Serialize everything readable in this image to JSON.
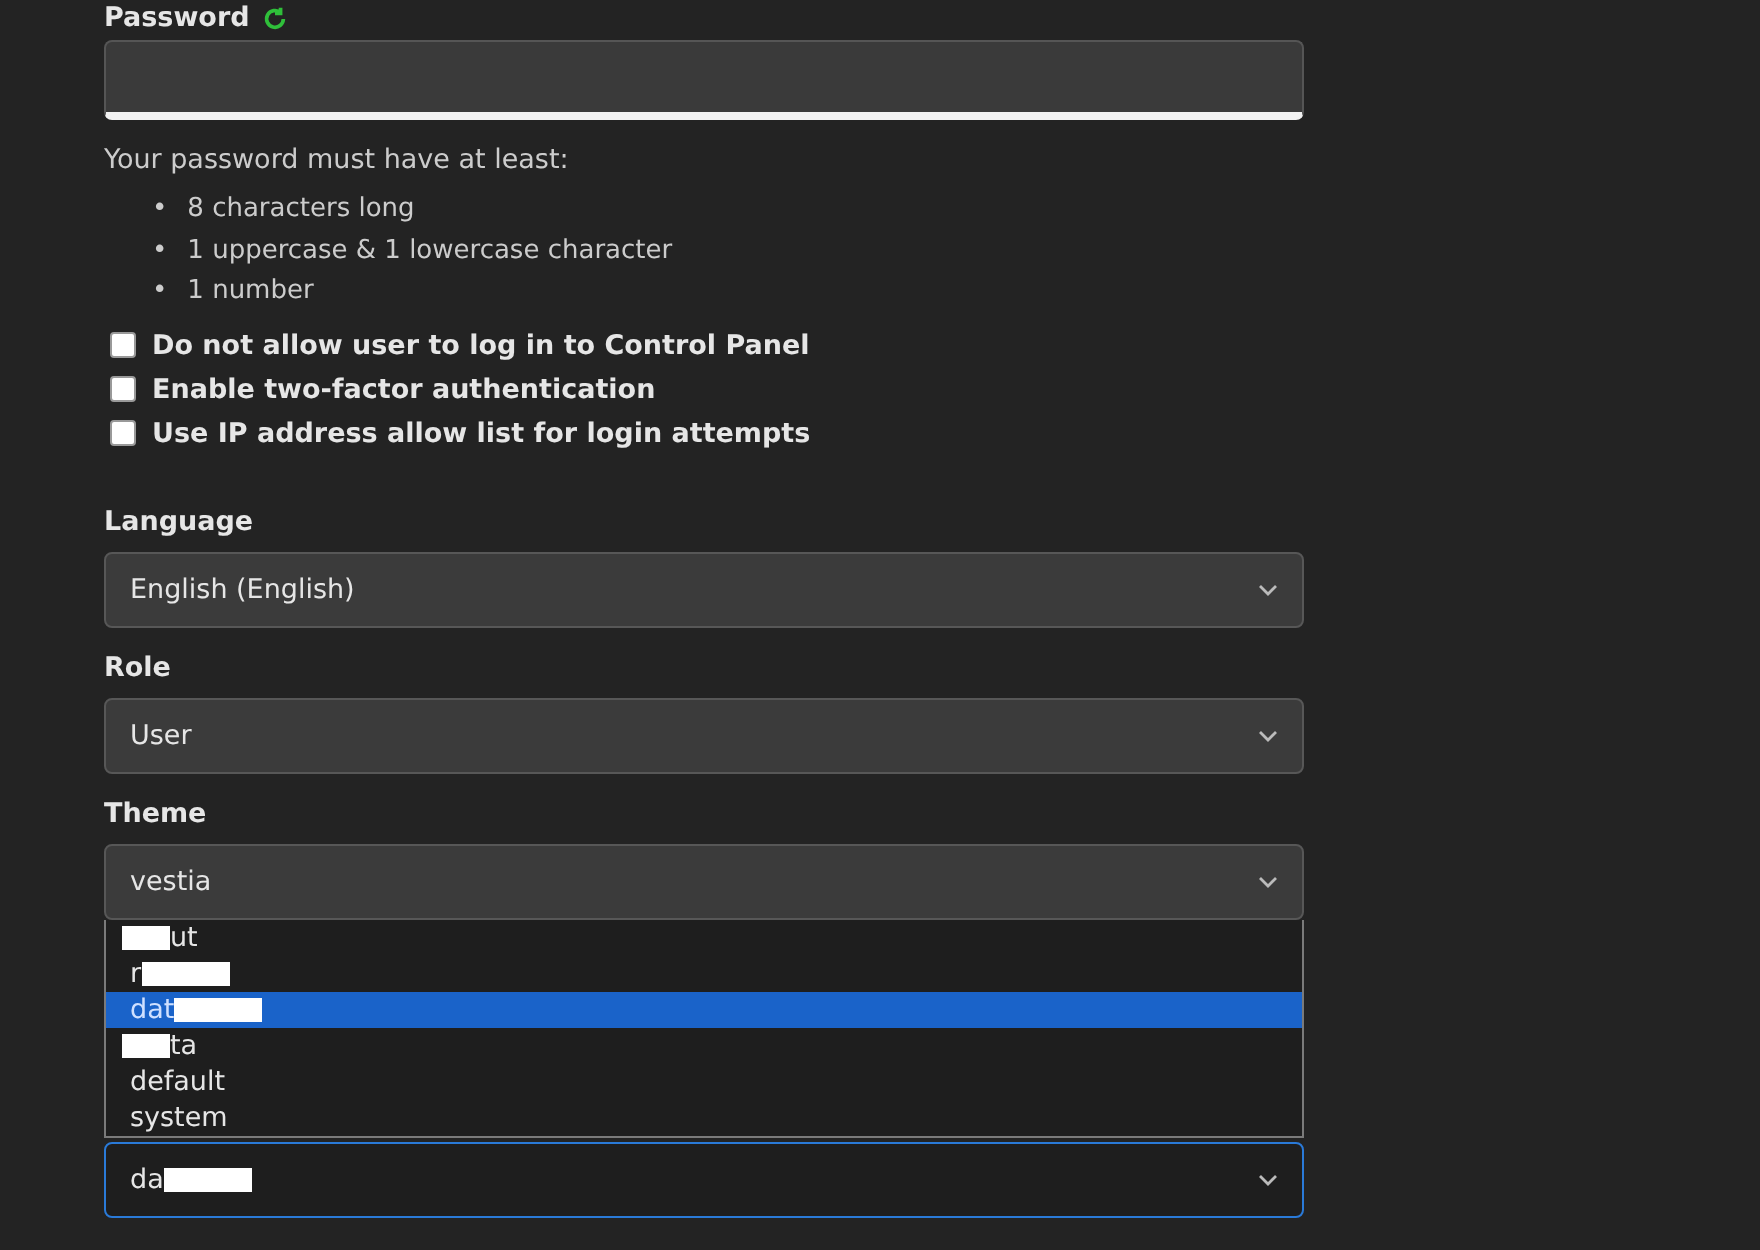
{
  "password": {
    "label": "Password",
    "hint": "Your password must have at least:",
    "rules": [
      {
        "bullet": "•",
        "text": "8 characters long"
      },
      {
        "bullet": "•",
        "text": "1 uppercase & 1 lowercase character"
      },
      {
        "bullet": "•",
        "text": "1 number"
      }
    ]
  },
  "checkboxes": [
    {
      "label": "Do not allow user to log in to Control Panel",
      "checked": false
    },
    {
      "label": "Enable two-factor authentication",
      "checked": false
    },
    {
      "label": "Use IP address allow list for login attempts",
      "checked": false
    }
  ],
  "selects": [
    {
      "label": "Language",
      "value": "English (English)"
    },
    {
      "label": "Role",
      "value": "User"
    },
    {
      "label": "Theme",
      "value": "vestia"
    }
  ],
  "theme_options": [
    {
      "text": "ut",
      "redacted_start": true,
      "redacted_end": false,
      "selected": false
    },
    {
      "text": "r",
      "redacted_start": false,
      "redacted_end": true,
      "selected": false
    },
    {
      "text": "dat",
      "redacted_start": false,
      "redacted_end": true,
      "selected": true
    },
    {
      "text": "ta",
      "redacted_start": true,
      "redacted_end": false,
      "selected": false
    },
    {
      "text": "default",
      "redacted_start": false,
      "redacted_end": false,
      "selected": false
    },
    {
      "text": "system",
      "redacted_start": false,
      "redacted_end": false,
      "selected": false
    }
  ],
  "focused_select": {
    "value": "da",
    "redacted_start": false,
    "redacted_end": true
  }
}
